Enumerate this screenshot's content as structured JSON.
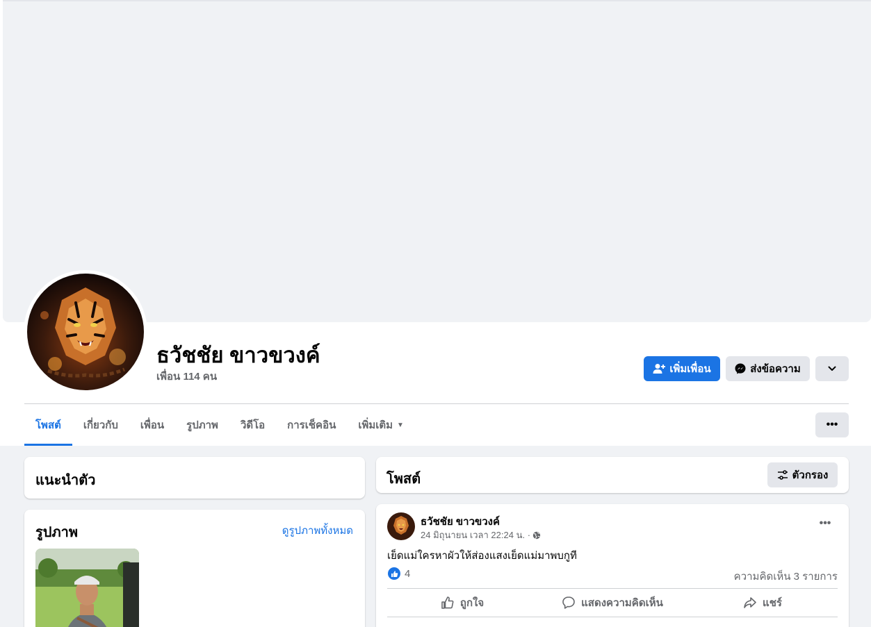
{
  "profile": {
    "name": "ธวัชชัย ขาวขวงค์",
    "friends_count": "เพื่อน 114 คน"
  },
  "actions": {
    "add_friend": "เพิ่มเพื่อน",
    "message": "ส่งข้อความ",
    "more_icon": "chevron-down-icon"
  },
  "tabs": [
    {
      "label": "โพสต์",
      "active": true
    },
    {
      "label": "เกี่ยวกับ",
      "active": false
    },
    {
      "label": "เพื่อน",
      "active": false
    },
    {
      "label": "รูปภาพ",
      "active": false
    },
    {
      "label": "วิดีโอ",
      "active": false
    },
    {
      "label": "การเช็คอิน",
      "active": false
    },
    {
      "label": "เพิ่มเติม",
      "active": false
    }
  ],
  "intro": {
    "title": "แนะนำตัว"
  },
  "photos": {
    "title": "รูปภาพ",
    "see_all": "ดูรูปภาพทั้งหมด"
  },
  "posts": {
    "title": "โพสต์",
    "filter_label": "ตัวกรอง"
  },
  "post": {
    "author": "ธวัชชัย ขาวขวงค์",
    "timestamp": "24 มิถุนายน เวลา 22:24 น. ·",
    "text": "เย็ดแม่ใครหาผัวให้ส่องแสงเย็ดแม่มาพบกูที",
    "like_count": "4",
    "comment_count": "ความคิดเห็น 3 รายการ",
    "like_label": "ถูกใจ",
    "comment_label": "แสดงความคิดเห็น",
    "share_label": "แชร์"
  },
  "colors": {
    "accent": "#1b74e4",
    "secondary_text": "#65676b",
    "button_gray": "#e4e6eb",
    "page_bg": "#f0f2f5"
  }
}
